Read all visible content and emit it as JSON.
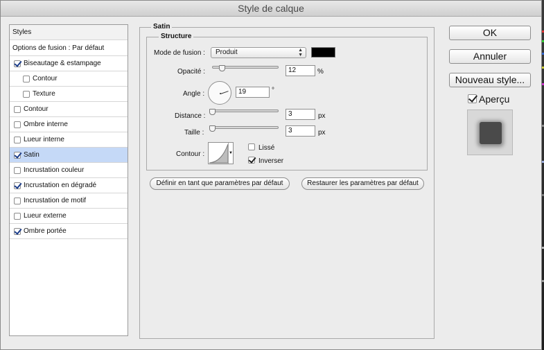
{
  "window": {
    "title": "Style de calque"
  },
  "styles_panel": {
    "header": "Styles",
    "blend_options": "Options de fusion : Par défaut",
    "items": [
      {
        "label": "Biseautage & estampage",
        "checked": true,
        "indent": false,
        "selected": false
      },
      {
        "label": "Contour",
        "checked": false,
        "indent": true,
        "selected": false
      },
      {
        "label": "Texture",
        "checked": false,
        "indent": true,
        "selected": false
      },
      {
        "label": "Contour",
        "checked": false,
        "indent": false,
        "selected": false
      },
      {
        "label": "Ombre interne",
        "checked": false,
        "indent": false,
        "selected": false
      },
      {
        "label": "Lueur interne",
        "checked": false,
        "indent": false,
        "selected": false
      },
      {
        "label": "Satin",
        "checked": true,
        "indent": false,
        "selected": true
      },
      {
        "label": "Incrustation couleur",
        "checked": false,
        "indent": false,
        "selected": false
      },
      {
        "label": "Incrustation en dégradé",
        "checked": true,
        "indent": false,
        "selected": false
      },
      {
        "label": "Incrustation de motif",
        "checked": false,
        "indent": false,
        "selected": false
      },
      {
        "label": "Lueur externe",
        "checked": false,
        "indent": false,
        "selected": false
      },
      {
        "label": "Ombre portée",
        "checked": true,
        "indent": false,
        "selected": false
      }
    ]
  },
  "satin": {
    "group_title": "Satin",
    "structure_title": "Structure",
    "blend_mode_label": "Mode de fusion :",
    "blend_mode_value": "Produit",
    "blend_arrows": "▲▼",
    "color": "#000000",
    "opacity_label": "Opacité :",
    "opacity_value": "12",
    "opacity_unit": "%",
    "opacity_fraction": 0.12,
    "angle_label": "Angle :",
    "angle_value": "19",
    "angle_unit": "°",
    "distance_label": "Distance :",
    "distance_value": "3",
    "distance_unit": "px",
    "size_label": "Taille :",
    "size_value": "3",
    "size_unit": "px",
    "contour_label": "Contour :",
    "antialias_label": "Lissé",
    "antialias_checked": false,
    "invert_label": "Inverser",
    "invert_checked": true,
    "set_default_button": "Définir en tant que paramètres par défaut",
    "reset_default_button": "Restaurer les paramètres par défaut"
  },
  "actions": {
    "ok": "OK",
    "cancel": "Annuler",
    "new_style": "Nouveau style...",
    "preview_label": "Aperçu",
    "preview_checked": true
  },
  "colors": {
    "selected_row": "#c5d9f7",
    "window_bg": "#ececec"
  }
}
